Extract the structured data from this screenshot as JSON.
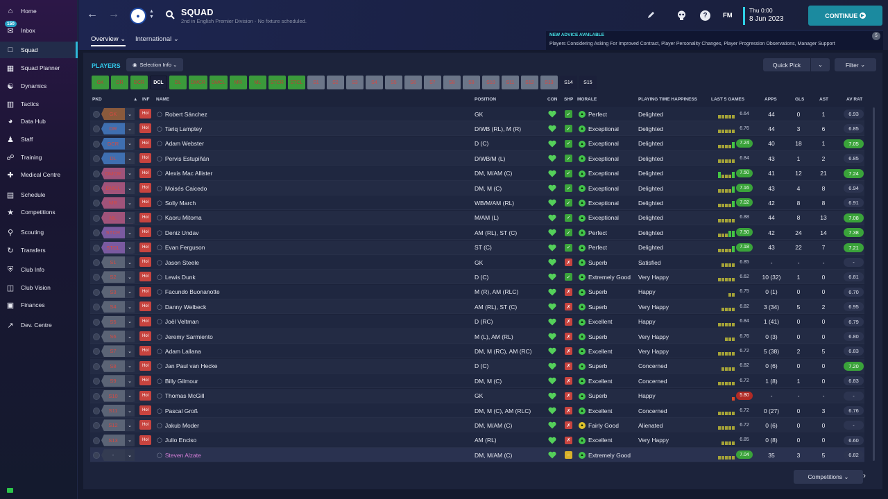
{
  "sidebar": {
    "items": [
      {
        "label": "Home",
        "icon": "home-icon"
      },
      {
        "label": "Inbox",
        "icon": "inbox-icon",
        "badge": "150"
      },
      {
        "label": "Squad",
        "icon": "squad-shirt-icon",
        "active": true
      },
      {
        "label": "Squad Planner",
        "icon": "planner-icon"
      },
      {
        "label": "Dynamics",
        "icon": "dynamics-icon"
      },
      {
        "label": "Tactics",
        "icon": "tactics-icon"
      },
      {
        "label": "Data Hub",
        "icon": "data-hub-icon"
      },
      {
        "label": "Staff",
        "icon": "staff-icon"
      },
      {
        "label": "Training",
        "icon": "training-icon"
      },
      {
        "label": "Medical Centre",
        "icon": "medical-icon"
      },
      {
        "label": "Schedule",
        "icon": "schedule-icon"
      },
      {
        "label": "Competitions",
        "icon": "trophy-icon"
      },
      {
        "label": "Scouting",
        "icon": "scouting-icon"
      },
      {
        "label": "Transfers",
        "icon": "transfers-icon"
      },
      {
        "label": "Club Info",
        "icon": "shield-icon"
      },
      {
        "label": "Club Vision",
        "icon": "vision-icon"
      },
      {
        "label": "Finances",
        "icon": "finances-icon"
      },
      {
        "label": "Dev. Centre",
        "icon": "dev-centre-icon"
      }
    ]
  },
  "header": {
    "title": "SQUAD",
    "subtitle": "2nd in English Premier Division - No fixture scheduled.",
    "tabs": [
      {
        "label": "Overview",
        "active": true
      },
      {
        "label": "International"
      }
    ],
    "date_day": "Thu 0:00",
    "date_date": "8 Jun 2023",
    "continue_label": "CONTINUE",
    "fm_label": "FM",
    "help_label": "?"
  },
  "advice": {
    "title": "NEW ADVICE AVAILABLE",
    "text": "Players Considering Asking For Improved Contract, Player Personality Changes, Player Progression Observations, Manager Support",
    "count": "5"
  },
  "toolbar": {
    "players_heading": "PLAYERS",
    "selection_info": "Selection Info",
    "quick_pick": "Quick Pick",
    "filter": "Filter"
  },
  "positions": [
    {
      "label": "GK",
      "state": "filled"
    },
    {
      "label": "DR",
      "state": "filled"
    },
    {
      "label": "DCR",
      "state": "filled"
    },
    {
      "label": "DCL",
      "state": "current"
    },
    {
      "label": "DL",
      "state": "filled"
    },
    {
      "label": "DMCR",
      "state": "filled"
    },
    {
      "label": "DMCL",
      "state": "filled"
    },
    {
      "label": "MR",
      "state": "filled"
    },
    {
      "label": "ML",
      "state": "filled"
    },
    {
      "label": "STCR",
      "state": "filled"
    },
    {
      "label": "STCL",
      "state": "filled"
    },
    {
      "label": "S1",
      "state": "empty"
    },
    {
      "label": "S2",
      "state": "empty"
    },
    {
      "label": "S3",
      "state": "empty"
    },
    {
      "label": "S4",
      "state": "empty"
    },
    {
      "label": "S5",
      "state": "empty"
    },
    {
      "label": "S6",
      "state": "empty"
    },
    {
      "label": "S7",
      "state": "empty"
    },
    {
      "label": "S8",
      "state": "empty"
    },
    {
      "label": "S9",
      "state": "empty"
    },
    {
      "label": "S10",
      "state": "empty"
    },
    {
      "label": "S11",
      "state": "empty"
    },
    {
      "label": "S12",
      "state": "empty"
    },
    {
      "label": "S13",
      "state": "empty"
    },
    {
      "label": "S14",
      "state": "extra"
    },
    {
      "label": "S15",
      "state": "extra"
    }
  ],
  "columns": {
    "pkd": "PKD",
    "inf": "INF",
    "name": "NAME",
    "position": "POSITION",
    "con": "CON",
    "shp": "SHP",
    "morale": "MORALE",
    "pth": "PLAYING TIME HAPPINESS",
    "last5": "LAST 5 GAMES",
    "apps": "APPS",
    "gls": "GLS",
    "ast": "AST",
    "avrat": "AV RAT"
  },
  "players": [
    {
      "pkd": "GK",
      "pkd_color": "#8a5a3c",
      "inf": "Hol",
      "name": "Robert Sánchez",
      "position": "GK",
      "shp": "up",
      "morale": "Perfect",
      "pth": "Delighted",
      "form": "yyyyy",
      "last": "6.64",
      "last_style": "",
      "apps": "44",
      "gls": "0",
      "ast": "1",
      "avrat": "6.93",
      "avrat_style": ""
    },
    {
      "pkd": "DR",
      "pkd_color": "#3f6fb0",
      "inf": "Hol",
      "name": "Tariq Lamptey",
      "position": "D/WB (RL), M (R)",
      "shp": "up",
      "morale": "Exceptional",
      "pth": "Delighted",
      "form": "yyyyy",
      "last": "6.76",
      "last_style": "",
      "apps": "44",
      "gls": "3",
      "ast": "6",
      "avrat": "6.85",
      "avrat_style": ""
    },
    {
      "pkd": "DCR",
      "pkd_color": "#3f6fb0",
      "inf": "Hol",
      "name": "Adam Webster",
      "position": "D (C)",
      "shp": "up",
      "morale": "Exceptional",
      "pth": "Delighted",
      "form": "yyyyg",
      "last": "7.24",
      "last_style": "hi",
      "apps": "40",
      "gls": "18",
      "ast": "1",
      "avrat": "7.05",
      "avrat_style": "hi"
    },
    {
      "pkd": "DL",
      "pkd_color": "#3f6fb0",
      "inf": "Hol",
      "name": "Pervis Estupiñán",
      "position": "D/WB/M (L)",
      "shp": "up",
      "morale": "Exceptional",
      "pth": "Delighted",
      "form": "yyyyy",
      "last": "6.84",
      "last_style": "",
      "apps": "43",
      "gls": "1",
      "ast": "2",
      "avrat": "6.85",
      "avrat_style": ""
    },
    {
      "pkd": "DMCR",
      "pkd_color": "#a0537a",
      "inf": "Hol",
      "name": "Alexis Mac Allister",
      "position": "DM, M/AM (C)",
      "shp": "up",
      "morale": "Exceptional",
      "pth": "Delighted",
      "form": "gyyyg",
      "last": "7.50",
      "last_style": "hi",
      "apps": "41",
      "gls": "12",
      "ast": "21",
      "avrat": "7.24",
      "avrat_style": "hi"
    },
    {
      "pkd": "DMCL",
      "pkd_color": "#a0537a",
      "inf": "Hol",
      "name": "Moisés Caicedo",
      "position": "DM, M (C)",
      "shp": "up",
      "morale": "Exceptional",
      "pth": "Delighted",
      "form": "yyyyg",
      "last": "7.16",
      "last_style": "hi",
      "apps": "43",
      "gls": "4",
      "ast": "8",
      "avrat": "6.94",
      "avrat_style": ""
    },
    {
      "pkd": "MR",
      "pkd_color": "#a0537a",
      "inf": "Hol",
      "name": "Solly March",
      "position": "WB/M/AM (RL)",
      "shp": "up",
      "morale": "Exceptional",
      "pth": "Delighted",
      "form": "yyyyg",
      "last": "7.02",
      "last_style": "hi",
      "apps": "42",
      "gls": "8",
      "ast": "8",
      "avrat": "6.91",
      "avrat_style": ""
    },
    {
      "pkd": "ML",
      "pkd_color": "#a0537a",
      "inf": "Hol",
      "name": "Kaoru Mitoma",
      "position": "M/AM (L)",
      "shp": "up",
      "morale": "Exceptional",
      "pth": "Delighted",
      "form": "yyyyy",
      "last": "6.88",
      "last_style": "",
      "apps": "44",
      "gls": "8",
      "ast": "13",
      "avrat": "7.08",
      "avrat_style": "hi"
    },
    {
      "pkd": "STCR",
      "pkd_color": "#7a5aa0",
      "inf": "Hol",
      "name": "Deniz Undav",
      "position": "AM (RL), ST (C)",
      "shp": "up",
      "morale": "Perfect",
      "pth": "Delighted",
      "form": "yyygg",
      "last": "7.50",
      "last_style": "hi",
      "apps": "42",
      "gls": "24",
      "ast": "14",
      "avrat": "7.38",
      "avrat_style": "hi"
    },
    {
      "pkd": "STCL",
      "pkd_color": "#7a5aa0",
      "inf": "Hol",
      "name": "Evan Ferguson",
      "position": "ST (C)",
      "shp": "up",
      "morale": "Perfect",
      "pth": "Delighted",
      "form": "yyyyg",
      "last": "7.18",
      "last_style": "hi",
      "apps": "43",
      "gls": "22",
      "ast": "7",
      "avrat": "7.21",
      "avrat_style": "hi"
    },
    {
      "pkd": "S1",
      "pkd_color": "#5b6476",
      "inf": "Hol",
      "name": "Jason Steele",
      "position": "GK",
      "shp": "down",
      "morale": "Superb",
      "pth": "Satisfied",
      "form": "yyyy",
      "last": "6.85",
      "last_style": "",
      "apps": "-",
      "gls": "-",
      "ast": "-",
      "avrat": "-",
      "avrat_style": ""
    },
    {
      "pkd": "S2",
      "pkd_color": "#5b6476",
      "inf": "Hol",
      "name": "Lewis Dunk",
      "position": "D (C)",
      "shp": "up",
      "morale": "Extremely Good",
      "pth": "Very Happy",
      "form": "yyyyy",
      "last": "6.62",
      "last_style": "",
      "apps": "10 (32)",
      "gls": "1",
      "ast": "0",
      "avrat": "6.81",
      "avrat_style": ""
    },
    {
      "pkd": "S3",
      "pkd_color": "#5b6476",
      "inf": "Hol",
      "name": "Facundo Buonanotte",
      "position": "M (R), AM (RLC)",
      "shp": "down",
      "morale": "Superb",
      "pth": "Happy",
      "form": "yy",
      "last": "6.75",
      "last_style": "",
      "apps": "0 (1)",
      "gls": "0",
      "ast": "0",
      "avrat": "6.70",
      "avrat_style": ""
    },
    {
      "pkd": "S4",
      "pkd_color": "#5b6476",
      "inf": "Hol",
      "name": "Danny Welbeck",
      "position": "AM (RL), ST (C)",
      "shp": "down",
      "morale": "Superb",
      "pth": "Very Happy",
      "form": "yyyy",
      "last": "6.82",
      "last_style": "",
      "apps": "3 (34)",
      "gls": "5",
      "ast": "2",
      "avrat": "6.95",
      "avrat_style": ""
    },
    {
      "pkd": "S5",
      "pkd_color": "#5b6476",
      "inf": "Hol",
      "name": "Joël Veltman",
      "position": "D (RC)",
      "shp": "down",
      "morale": "Excellent",
      "pth": "Happy",
      "form": "yyyyy",
      "last": "6.84",
      "last_style": "",
      "apps": "1 (41)",
      "gls": "0",
      "ast": "0",
      "avrat": "6.79",
      "avrat_style": ""
    },
    {
      "pkd": "S6",
      "pkd_color": "#5b6476",
      "inf": "Hol",
      "name": "Jeremy Sarmiento",
      "position": "M (L), AM (RL)",
      "shp": "down",
      "morale": "Superb",
      "pth": "Very Happy",
      "form": "yyy",
      "last": "6.76",
      "last_style": "",
      "apps": "0 (3)",
      "gls": "0",
      "ast": "0",
      "avrat": "6.80",
      "avrat_style": ""
    },
    {
      "pkd": "S7",
      "pkd_color": "#5b6476",
      "inf": "Hol",
      "name": "Adam Lallana",
      "position": "DM, M (RC), AM (RC)",
      "shp": "down",
      "morale": "Excellent",
      "pth": "Very Happy",
      "form": "yyyyy",
      "last": "6.72",
      "last_style": "",
      "apps": "5 (38)",
      "gls": "2",
      "ast": "5",
      "avrat": "6.83",
      "avrat_style": ""
    },
    {
      "pkd": "S8",
      "pkd_color": "#5b6476",
      "inf": "Hol",
      "name": "Jan Paul van Hecke",
      "position": "D (C)",
      "shp": "down",
      "morale": "Superb",
      "pth": "Concerned",
      "form": "yyyy",
      "last": "6.82",
      "last_style": "",
      "apps": "0 (6)",
      "gls": "0",
      "ast": "0",
      "avrat": "7.20",
      "avrat_style": "hi"
    },
    {
      "pkd": "S9",
      "pkd_color": "#5b6476",
      "inf": "Hol",
      "name": "Billy Gilmour",
      "position": "DM, M (C)",
      "shp": "down",
      "morale": "Excellent",
      "pth": "Concerned",
      "form": "yyyyy",
      "last": "6.72",
      "last_style": "",
      "apps": "1 (8)",
      "gls": "1",
      "ast": "0",
      "avrat": "6.83",
      "avrat_style": ""
    },
    {
      "pkd": "S10",
      "pkd_color": "#5b6476",
      "inf": "Hol",
      "name": "Thomas McGill",
      "position": "GK",
      "shp": "down",
      "morale": "Superb",
      "pth": "Happy",
      "form": "r",
      "last": "5.80",
      "last_style": "lo",
      "apps": "-",
      "gls": "-",
      "ast": "-",
      "avrat": "-",
      "avrat_style": ""
    },
    {
      "pkd": "S11",
      "pkd_color": "#5b6476",
      "inf": "Hol",
      "name": "Pascal Groß",
      "position": "DM, M (C), AM (RLC)",
      "shp": "down",
      "morale": "Excellent",
      "pth": "Concerned",
      "form": "yyyyy",
      "last": "6.72",
      "last_style": "",
      "apps": "0 (27)",
      "gls": "0",
      "ast": "3",
      "avrat": "6.76",
      "avrat_style": ""
    },
    {
      "pkd": "S12",
      "pkd_color": "#5b6476",
      "inf": "Hol",
      "name": "Jakub Moder",
      "position": "DM, M/AM (C)",
      "shp": "down",
      "morale": "Fairly Good",
      "pth": "Alienated",
      "form": "yyyyy",
      "last": "6.72",
      "last_style": "",
      "apps": "0 (6)",
      "gls": "0",
      "ast": "0",
      "avrat": "-",
      "avrat_style": ""
    },
    {
      "pkd": "S13",
      "pkd_color": "#5b6476",
      "inf": "Hol",
      "name": "Julio Enciso",
      "position": "AM (RL)",
      "shp": "down",
      "morale": "Excellent",
      "pth": "Very Happy",
      "form": "yyyy",
      "last": "6.85",
      "last_style": "",
      "apps": "0 (8)",
      "gls": "0",
      "ast": "0",
      "avrat": "6.60",
      "avrat_style": ""
    },
    {
      "pkd": "-",
      "pkd_color": "#343c52",
      "inf": "",
      "name": "Steven Alzate",
      "position": "DM, M/AM (C)",
      "shp": "neutral",
      "morale": "Extremely Good",
      "pth": "",
      "form": "yyyyy",
      "last": "7.04",
      "last_style": "hi",
      "apps": "35",
      "gls": "3",
      "ast": "5",
      "avrat": "6.82",
      "avrat_style": "",
      "loan": true
    }
  ],
  "footer": {
    "competitions": "Competitions"
  },
  "colors": {
    "accent": "#2fb8d8",
    "continue": "#1b8a9f",
    "good": "#3aa33a",
    "bad": "#c8443f",
    "heart": "#54d05a",
    "loan_name": "#d57fd8"
  }
}
